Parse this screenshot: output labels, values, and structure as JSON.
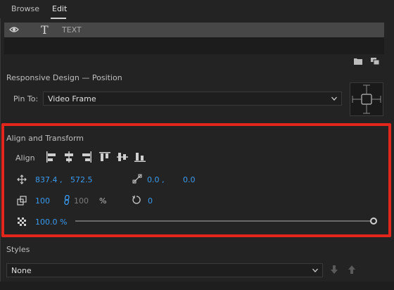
{
  "tabs": [
    {
      "label": "Browse"
    },
    {
      "label": "Edit"
    }
  ],
  "layers": {
    "items": [
      {
        "name": "TEXT",
        "type_glyph": "T"
      }
    ]
  },
  "responsive": {
    "title": "Responsive Design — Position",
    "pin_to_label": "Pin To:",
    "pin_to_value": "Video Frame"
  },
  "align_transform": {
    "title": "Align and Transform",
    "align_label": "Align",
    "position_x": "837.4 ,",
    "position_y": "572.5",
    "anchor_x": "0.0 ,",
    "anchor_y": "0.0",
    "scale_w": "100",
    "scale_h": "100",
    "scale_unit": "%",
    "rotation": "0",
    "opacity": "100.0 %",
    "opacity_fraction": 1.0
  },
  "styles": {
    "title": "Styles",
    "value": "None"
  },
  "colors": {
    "accent_blue": "#3a9bf0",
    "highlight_red": "#e3261c",
    "background": "#232323"
  },
  "icons": [
    "eye-icon",
    "text-layer-icon",
    "folder-icon",
    "new-item-icon",
    "align-left-icon",
    "align-center-horizontal-icon",
    "align-right-icon",
    "align-top-icon",
    "align-center-vertical-icon",
    "align-bottom-icon",
    "position-move-icon",
    "anchor-point-icon",
    "scale-icon",
    "link-icon",
    "rotation-icon",
    "opacity-checker-icon",
    "chevron-down-icon",
    "arrow-down-icon",
    "arrow-up-icon"
  ]
}
